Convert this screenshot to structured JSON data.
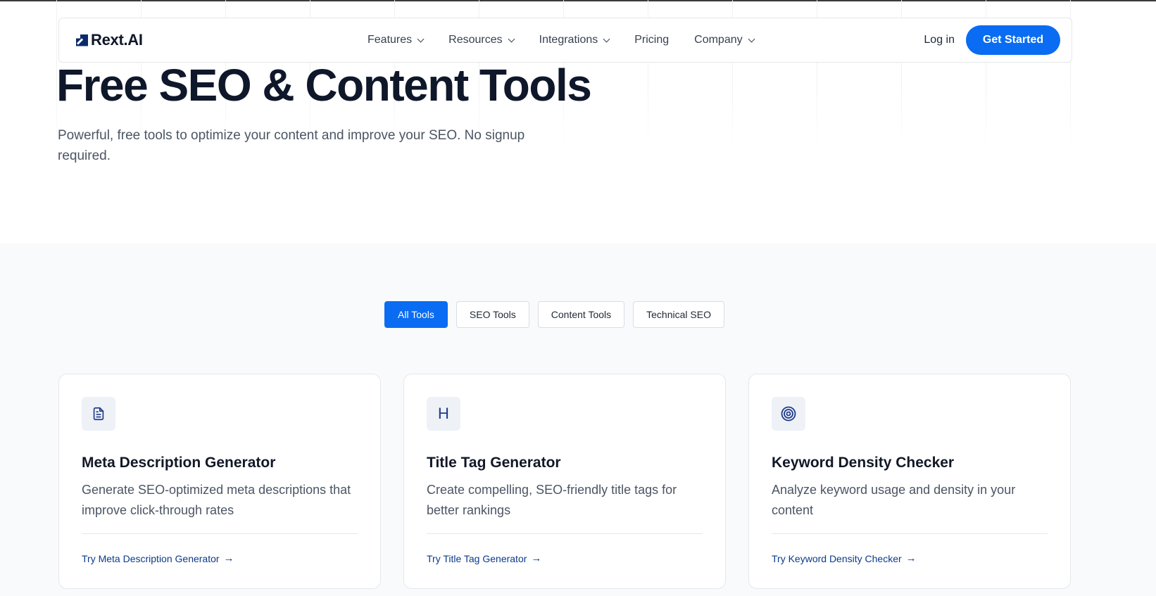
{
  "brand": {
    "name": "Rext.AI"
  },
  "nav": {
    "items": [
      {
        "label": "Features",
        "has_dropdown": true
      },
      {
        "label": "Resources",
        "has_dropdown": true
      },
      {
        "label": "Integrations",
        "has_dropdown": true
      },
      {
        "label": "Pricing",
        "has_dropdown": false
      },
      {
        "label": "Company",
        "has_dropdown": true
      }
    ],
    "login_label": "Log in",
    "cta_label": "Get Started"
  },
  "hero": {
    "title": "Free SEO & Content Tools",
    "subtitle": "Powerful, free tools to optimize your content and improve your SEO. No signup required."
  },
  "filters": {
    "items": [
      {
        "label": "All Tools",
        "active": true
      },
      {
        "label": "SEO Tools",
        "active": false
      },
      {
        "label": "Content Tools",
        "active": false
      },
      {
        "label": "Technical SEO",
        "active": false
      }
    ]
  },
  "cards": [
    {
      "icon": "document-icon",
      "title": "Meta Description Generator",
      "description": "Generate SEO-optimized meta descriptions that improve click-through rates",
      "link": "Try Meta Description Generator"
    },
    {
      "icon": "heading-icon",
      "icon_text": "H",
      "title": "Title Tag Generator",
      "description": "Create compelling, SEO-friendly title tags for better rankings",
      "link": "Try Title Tag Generator"
    },
    {
      "icon": "target-icon",
      "title": "Keyword Density Checker",
      "description": "Analyze keyword usage and density in your content",
      "link": "Try Keyword Density Checker"
    }
  ],
  "colors": {
    "accent": "#0a6cf2",
    "brand_dark": "#0b2a6b",
    "heading": "#0f172a",
    "section_bg": "#f8fafc"
  }
}
